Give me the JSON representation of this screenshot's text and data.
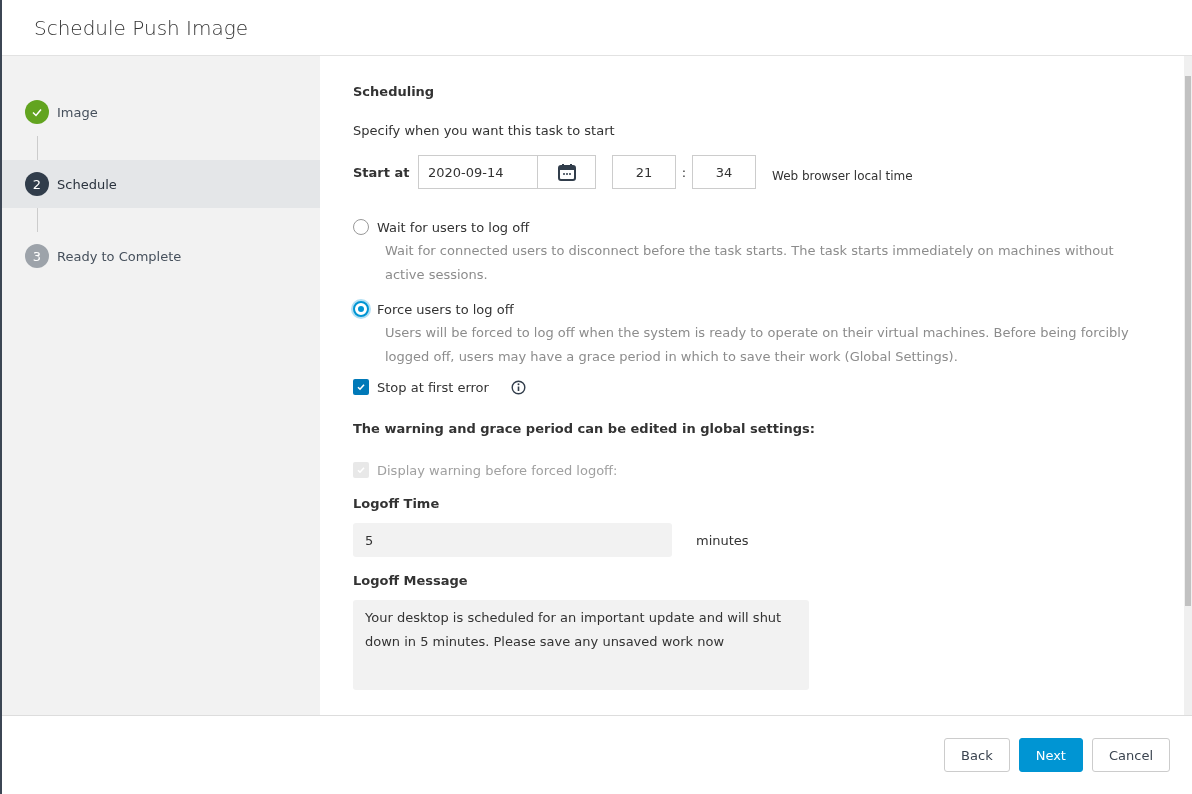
{
  "window": {
    "title": "Schedule Push Image"
  },
  "steps": [
    {
      "label": "Image",
      "completed": true,
      "selected": false
    },
    {
      "number": "2",
      "label": "Schedule",
      "completed": false,
      "selected": true
    },
    {
      "number": "3",
      "label": "Ready to Complete",
      "completed": false,
      "selected": false
    }
  ],
  "section_title": "Scheduling",
  "intro": "Specify when you want this task to start",
  "start_at": {
    "label": "Start at",
    "date": "2020-09-14",
    "hour": "21",
    "separator": ":",
    "minute": "34",
    "note": "Web browser local time"
  },
  "logoff_options": [
    {
      "label": "Wait for users to log off",
      "selected": false,
      "description": "Wait for connected users to disconnect before the task starts. The task starts immediately on machines without active sessions."
    },
    {
      "label": "Force users to log off",
      "selected": true,
      "description": "Users will be forced to log off when the system is ready to operate on their virtual machines. Before being forcibly logged off, users may have a grace period in which to save their work (Global Settings)."
    }
  ],
  "stop_at_first_error": {
    "label": "Stop at first error",
    "checked": true,
    "disabled": false
  },
  "global_note": "The warning and grace period can be edited in global settings:",
  "display_warning": {
    "label": "Display warning before forced logoff:",
    "checked": true,
    "disabled": true
  },
  "logoff_time": {
    "label": "Logoff Time",
    "value": "5",
    "unit": "minutes"
  },
  "logoff_message": {
    "label": "Logoff Message",
    "value": "Your desktop is scheduled for an important update and will shut down in 5 minutes. Please save any unsaved work now"
  },
  "buttons": [
    {
      "label": "Back",
      "kind": "secondary"
    },
    {
      "label": "Next",
      "kind": "primary"
    },
    {
      "label": "Cancel",
      "kind": "secondary"
    }
  ]
}
